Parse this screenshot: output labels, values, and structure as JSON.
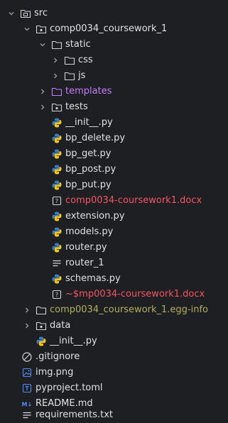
{
  "tree": {
    "items": [
      {
        "label": "src"
      },
      {
        "label": "comp0034_coursework_1"
      },
      {
        "label": "static"
      },
      {
        "label": "css"
      },
      {
        "label": "js"
      },
      {
        "label": "templates"
      },
      {
        "label": "tests"
      },
      {
        "label": "__init__.py"
      },
      {
        "label": "bp_delete.py"
      },
      {
        "label": "bp_get.py"
      },
      {
        "label": "bp_post.py"
      },
      {
        "label": "bp_put.py"
      },
      {
        "label": "comp0034-coursework1.docx"
      },
      {
        "label": "extension.py"
      },
      {
        "label": "models.py"
      },
      {
        "label": "router.py"
      },
      {
        "label": "router_1"
      },
      {
        "label": "schemas.py"
      },
      {
        "label": "~$mp0034-coursework1.docx"
      },
      {
        "label": "comp0034_coursework_1.egg-info"
      },
      {
        "label": "data"
      },
      {
        "label": "__init__.py"
      },
      {
        "label": ".gitignore"
      },
      {
        "label": "img.png"
      },
      {
        "label": "pyproject.toml"
      },
      {
        "label": "README.md"
      },
      {
        "label": "requirements.txt"
      }
    ]
  },
  "colors": {
    "background": "#1e1f22",
    "text_default": "#dfe1e5",
    "text_excluded": "#c77dff",
    "text_untracked": "#f75464",
    "text_ignored": "#b3ae60",
    "python_blue": "#3e7cc0",
    "python_yellow": "#f5c518"
  }
}
